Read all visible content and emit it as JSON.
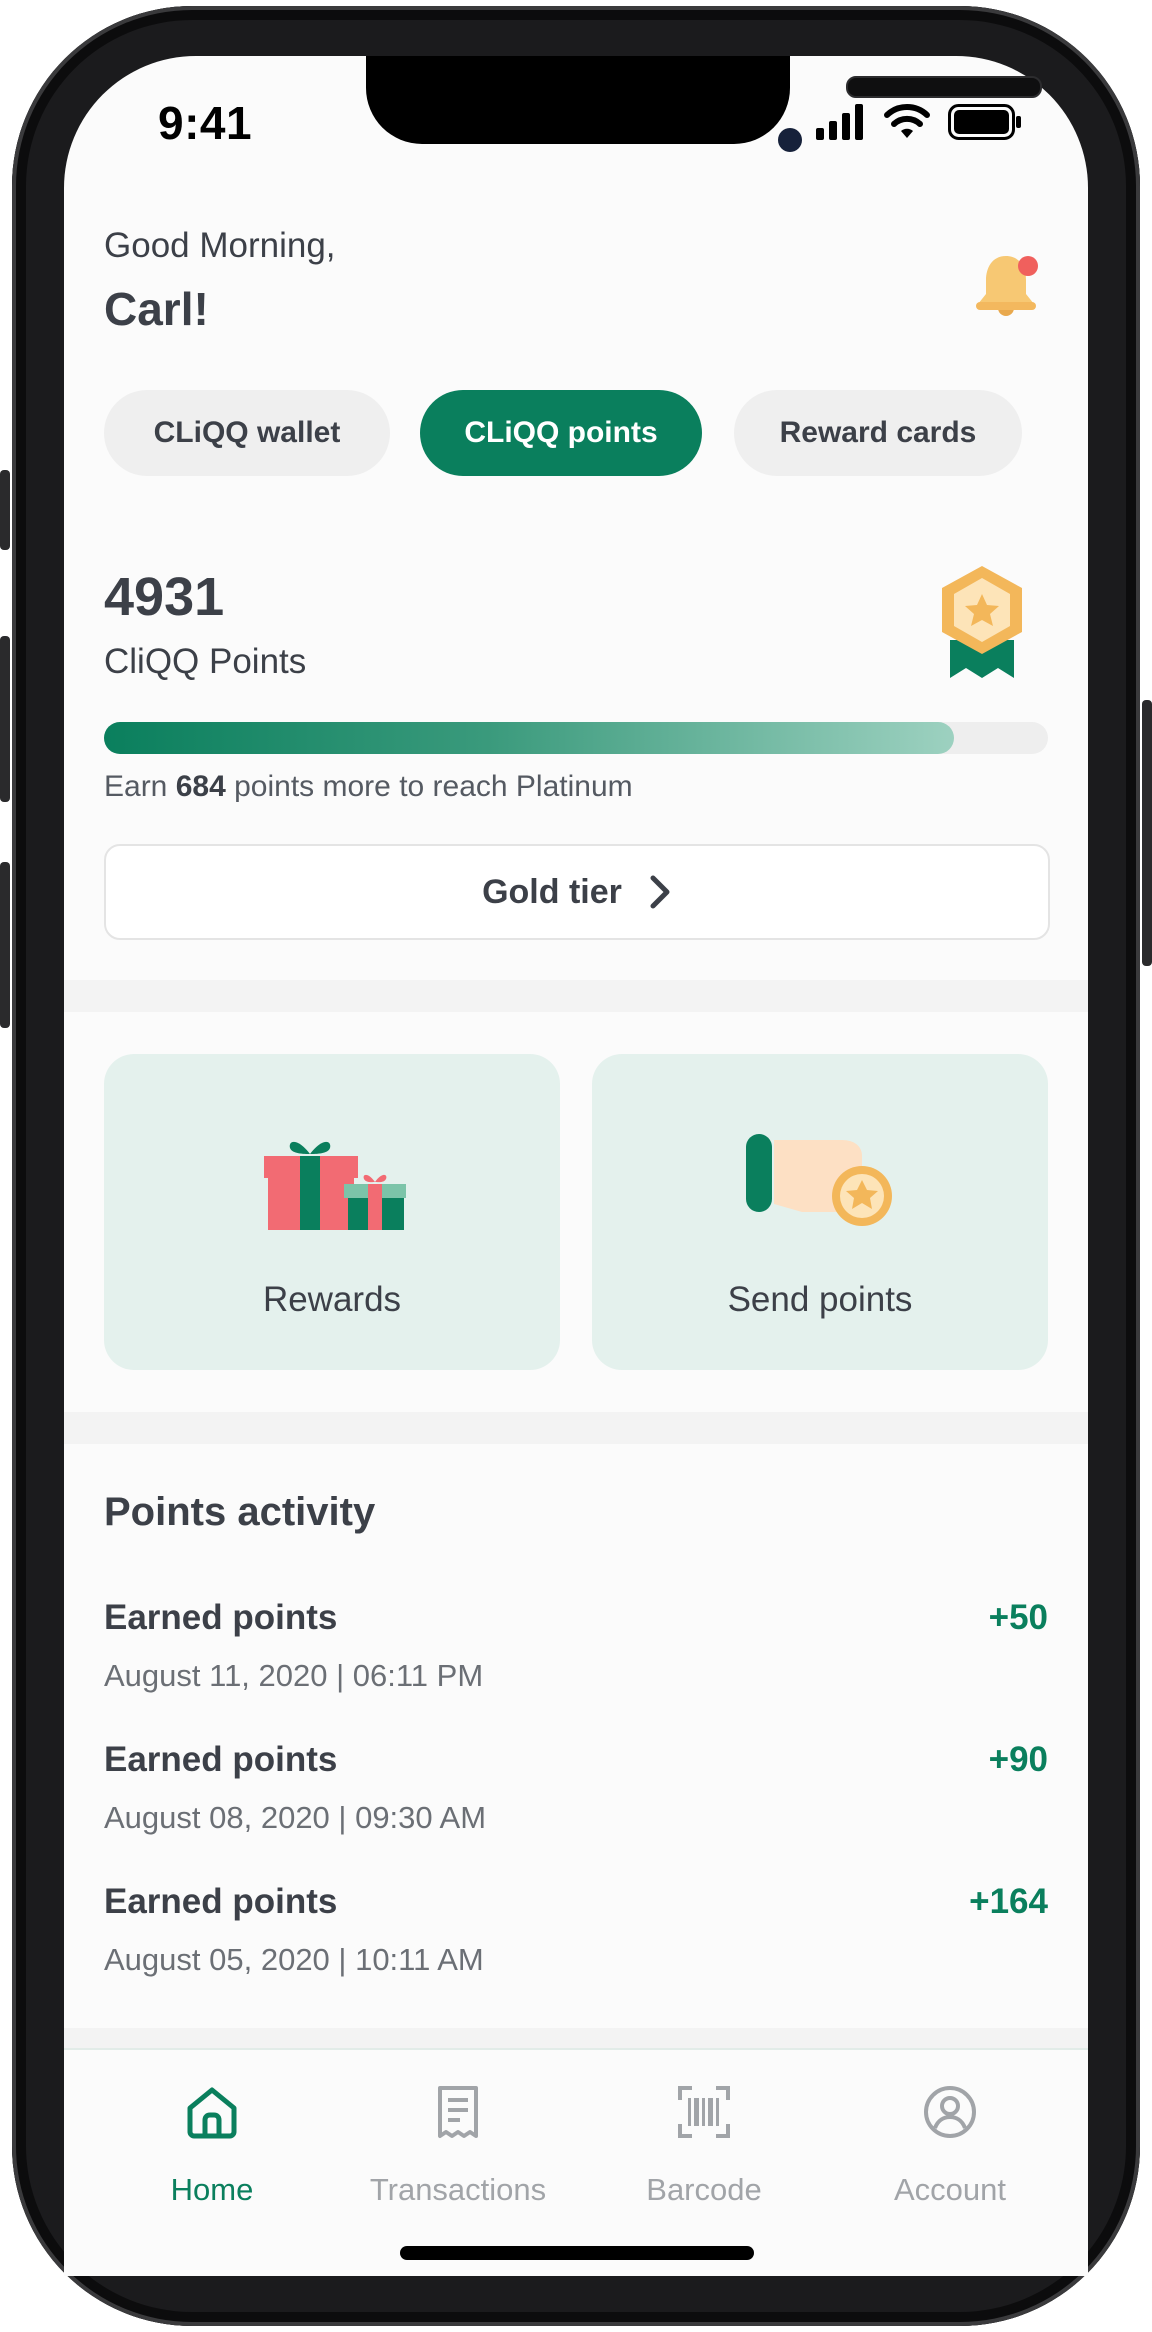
{
  "status_bar": {
    "time": "9:41"
  },
  "header": {
    "greeting": "Good Morning,",
    "name": "Carl!"
  },
  "tabs": [
    {
      "label": "CLiQQ wallet",
      "active": false
    },
    {
      "label": "CLiQQ points",
      "active": true
    },
    {
      "label": "Reward cards",
      "active": false
    }
  ],
  "points": {
    "value": "4931",
    "label": "CliQQ Points",
    "progress_fraction": 0.9,
    "earn_prefix": "Earn ",
    "earn_amount": "684",
    "earn_suffix": " points more to reach Platinum",
    "tier_button": "Gold tier"
  },
  "actions": [
    {
      "label": "Rewards",
      "icon": "gift-icon"
    },
    {
      "label": "Send points",
      "icon": "hand-star-icon"
    }
  ],
  "activity": {
    "title": "Points activity",
    "items": [
      {
        "title": "Earned points",
        "date": "August 11, 2020 | 06:11 PM",
        "amount": "+50"
      },
      {
        "title": "Earned points",
        "date": "August 08, 2020 | 09:30 AM",
        "amount": "+90"
      },
      {
        "title": "Earned points",
        "date": "August 05, 2020 | 10:11 AM",
        "amount": "+164"
      }
    ]
  },
  "bottom_nav": [
    {
      "label": "Home",
      "icon": "home-icon",
      "active": true
    },
    {
      "label": "Transactions",
      "icon": "receipt-icon",
      "active": false
    },
    {
      "label": "Barcode",
      "icon": "barcode-icon",
      "active": false
    },
    {
      "label": "Account",
      "icon": "account-icon",
      "active": false
    }
  ],
  "colors": {
    "accent": "#0a7f5d",
    "card_bg": "#e4f1ed",
    "badge": "#f7c873",
    "notification_dot": "#f0605d"
  }
}
